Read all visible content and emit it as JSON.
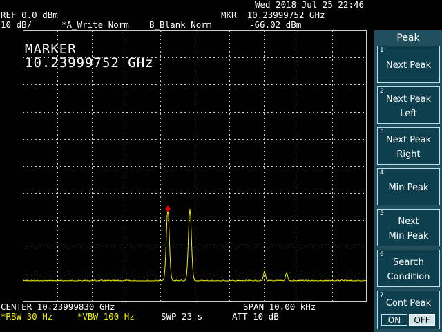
{
  "header": {
    "datetime": "Wed 2018 Jul 25 22:46",
    "ref_level": "REF 0.0 dBm",
    "scale": "10 dB/",
    "trace_a": "*A_Write Norm",
    "trace_b": "B_Blank Norm",
    "marker_freq_label": "MKR  10.23999752 GHz",
    "marker_ampl": "-66.02 dBm"
  },
  "screen": {
    "marker_title": "MARKER",
    "marker_value": "10.23999752 GHz"
  },
  "footer": {
    "center": "CENTER 10.23999830 GHz",
    "span": "SPAN 10.00 kHz",
    "rbw": "*RBW 30 Hz",
    "vbw": "*VBW 100 Hz",
    "sweep": "SWP 23 s",
    "atten": "ATT 10 dB"
  },
  "softkeys": {
    "title": "Peak",
    "keys": [
      {
        "num": "1",
        "line1": "",
        "line2": "Next Peak"
      },
      {
        "num": "2",
        "line1": "Next Peak",
        "line2": "Left"
      },
      {
        "num": "3",
        "line1": "Next Peak",
        "line2": "Right"
      },
      {
        "num": "4",
        "line1": "",
        "line2": "Min Peak"
      },
      {
        "num": "5",
        "line1": "Next",
        "line2": "Min Peak"
      },
      {
        "num": "6",
        "line1": "Search",
        "line2": "Condition"
      },
      {
        "num": "7",
        "line1": "Cont Peak",
        "line2": ""
      }
    ],
    "toggle_on": "ON",
    "toggle_off": "OFF"
  },
  "colors": {
    "trace": "#f0f000",
    "grid": "#c8c8c8",
    "marker": "#e00000",
    "softkey_bg": "#0e3f4f",
    "panel_bg": "#1f4f5c"
  }
}
